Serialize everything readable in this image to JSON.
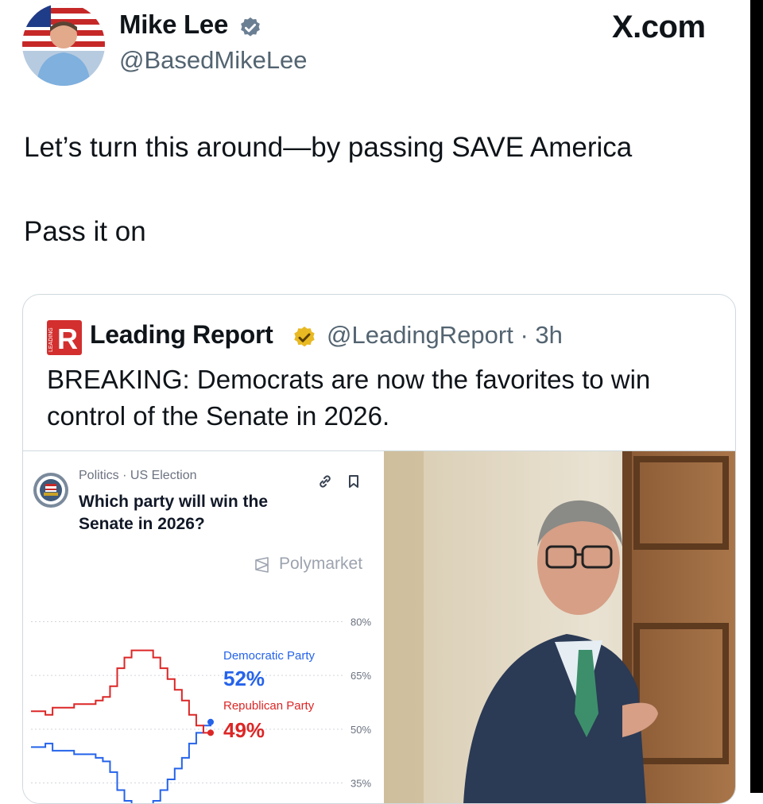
{
  "author": {
    "name": "Mike Lee",
    "handle": "@BasedMikeLee"
  },
  "brand": "X.com",
  "tweet": {
    "line1": "Let’s turn this around—by passing SAVE America",
    "line2": "Pass it on"
  },
  "quoted": {
    "name": "Leading Report",
    "handle_time": "@LeadingReport · 3h",
    "text_line1": "BREAKING: Democrats are now the favorites to win",
    "text_line2": "control of the Senate in 2026.",
    "logo_letter": "R",
    "logo_side_text": "LEADING"
  },
  "market": {
    "crumb": "Politics · US Election",
    "question": "Which party will win the Senate in 2026?",
    "source": "Polymarket",
    "icons": [
      "link-icon",
      "bookmark-icon"
    ]
  },
  "chart_data": {
    "type": "line",
    "y_ticks": [
      "80%",
      "65%",
      "50%",
      "35%"
    ],
    "ylim": [
      30,
      85
    ],
    "series": [
      {
        "name": "Democratic Party",
        "color": "#2563eb",
        "current_label": "52%",
        "values": [
          45,
          45,
          46,
          44,
          44,
          44,
          43,
          43,
          43,
          42,
          41,
          38,
          33,
          30,
          28,
          28,
          28,
          30,
          33,
          36,
          39,
          42,
          46,
          49,
          51,
          52
        ]
      },
      {
        "name": "Republican Party",
        "color": "#dc2626",
        "current_label": "49%",
        "values": [
          55,
          55,
          54,
          56,
          56,
          56,
          57,
          57,
          57,
          58,
          59,
          62,
          67,
          70,
          72,
          72,
          72,
          70,
          67,
          64,
          61,
          58,
          54,
          51,
          49,
          49
        ]
      }
    ],
    "colors": {
      "dem": "#2563eb",
      "rep": "#dc2626"
    }
  }
}
